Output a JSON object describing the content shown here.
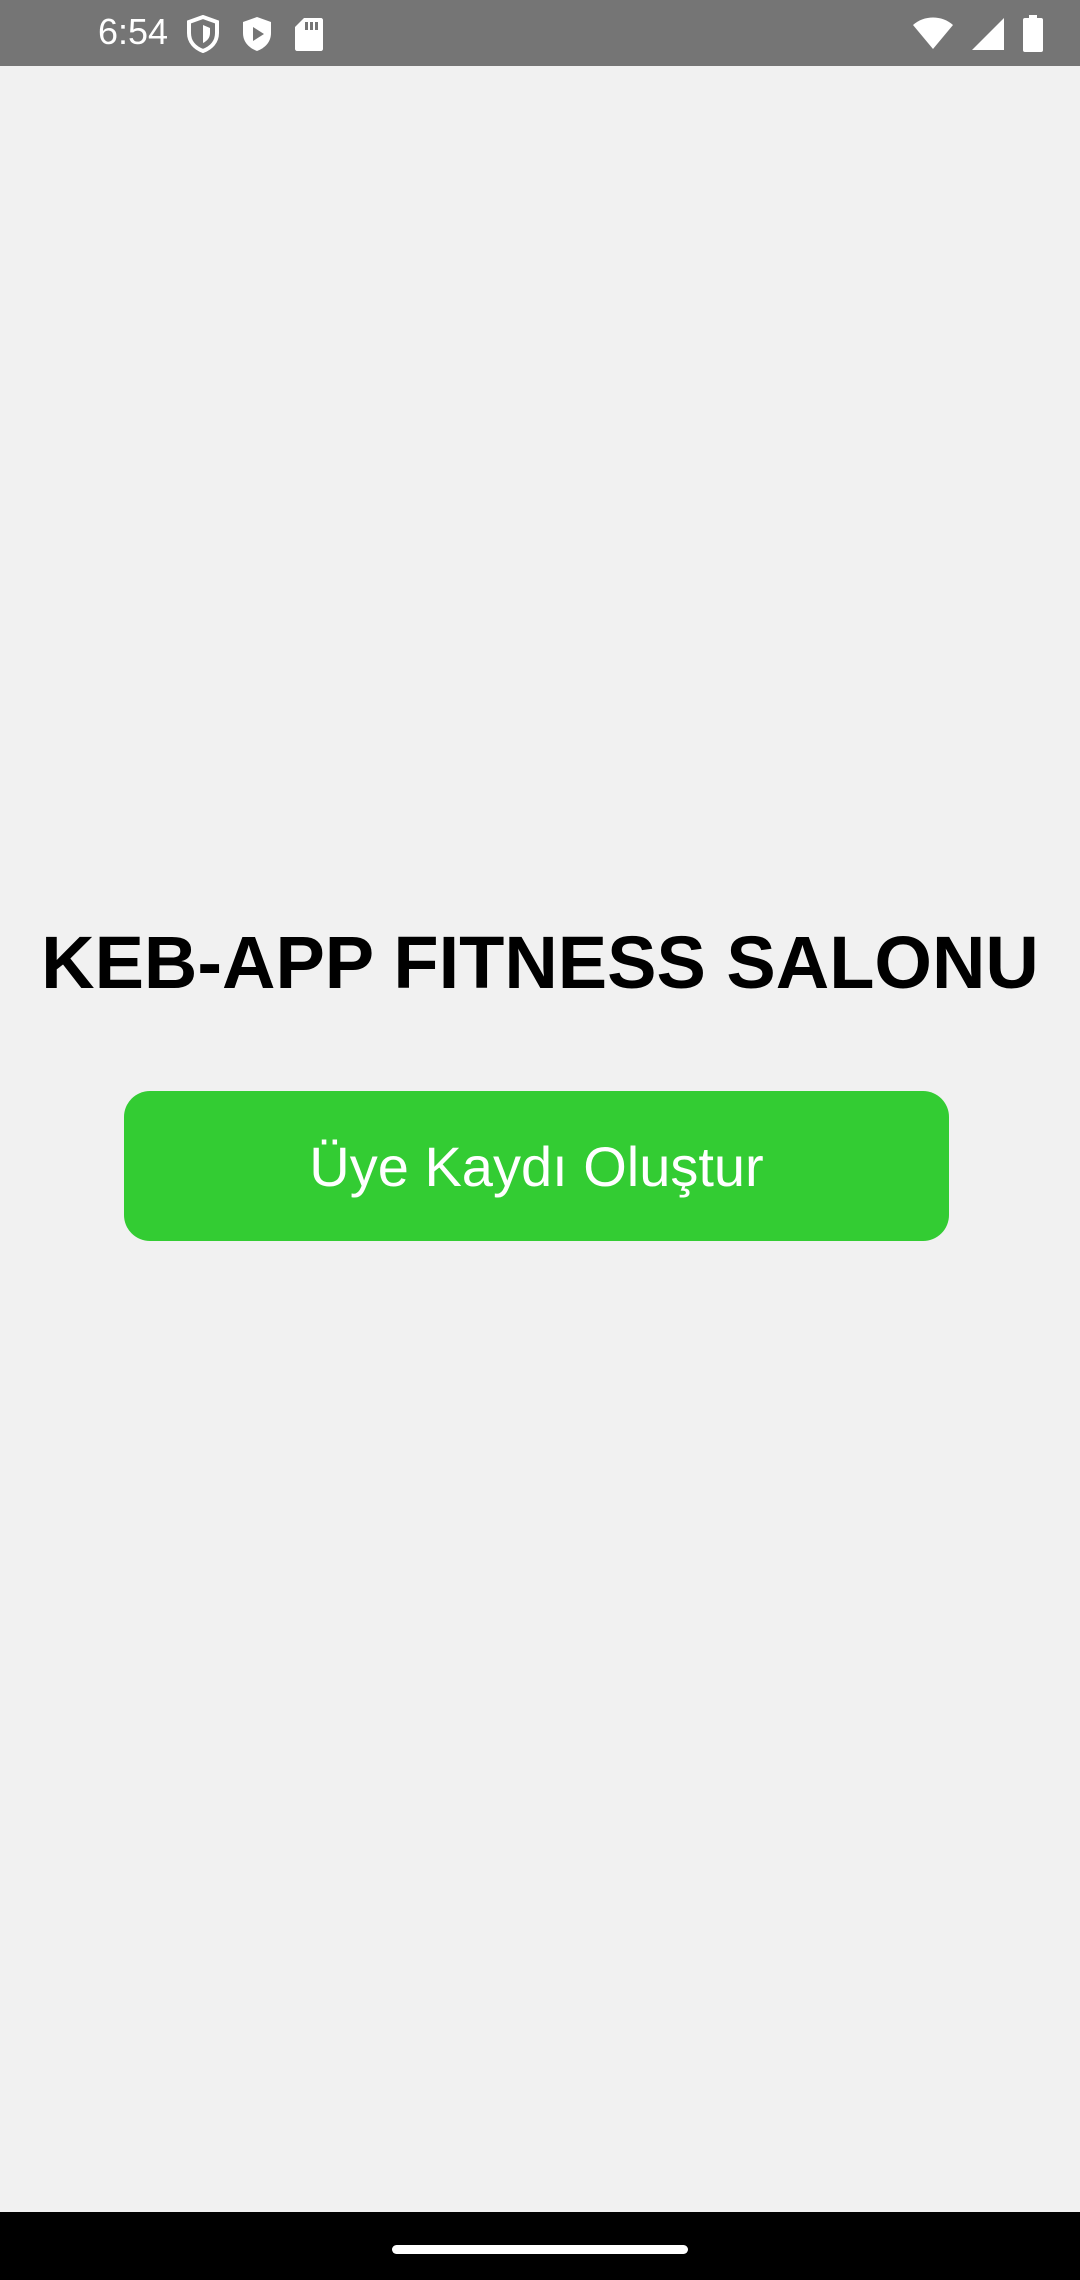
{
  "status_bar": {
    "time": "6:54",
    "left_icons": [
      "vpn-shield-icon",
      "play-store-icon",
      "sd-card-icon"
    ],
    "right_icons": [
      "wifi-icon",
      "cellular-signal-icon",
      "battery-icon"
    ]
  },
  "main": {
    "title": "KEB-APP FITNESS SALONU",
    "register_button_label": "Üye Kaydı Oluştur"
  },
  "colors": {
    "status_bar_bg": "#757575",
    "background": "#f1f1f1",
    "button_bg": "#33cc33",
    "button_text": "#ffffff",
    "title_text": "#000000",
    "nav_bar_bg": "#000000"
  }
}
